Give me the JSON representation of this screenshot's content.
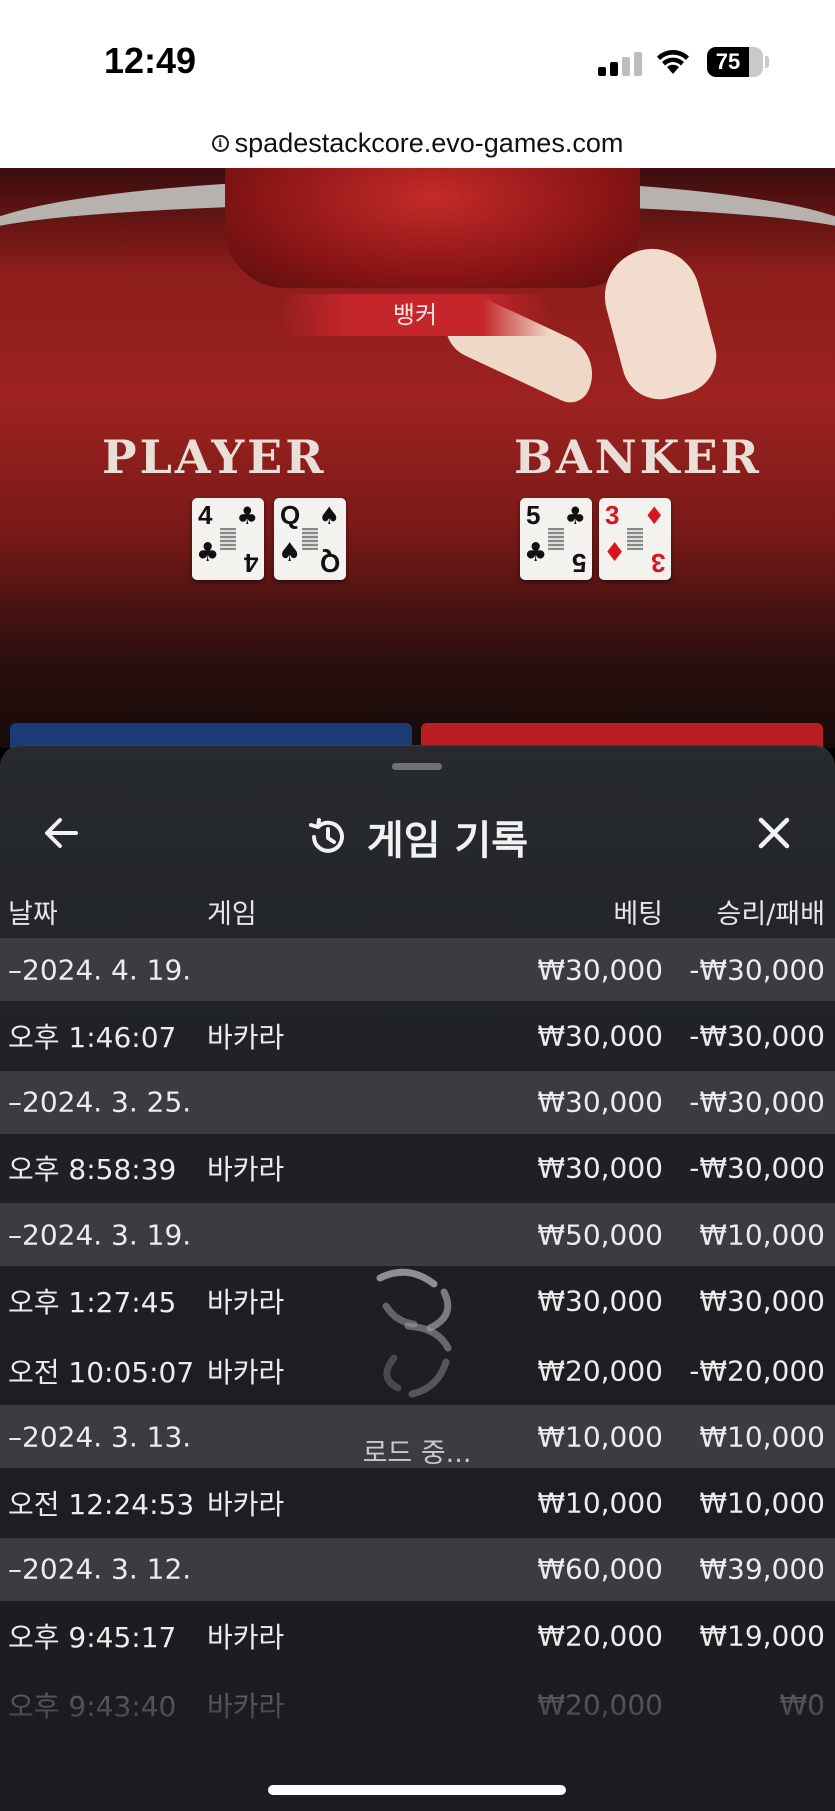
{
  "status_bar": {
    "time": "12:49",
    "battery": "75",
    "battery_level": 0.75
  },
  "browser": {
    "url": "spadestackcore.evo-games.com"
  },
  "game_view": {
    "dealer_tag": "뱅커",
    "player_label": "PLAYER",
    "banker_label": "BANKER",
    "player_cards": [
      {
        "rank": "4",
        "suit": "♣",
        "color": "black"
      },
      {
        "rank": "Q",
        "suit": "♠",
        "color": "black"
      }
    ],
    "banker_cards": [
      {
        "rank": "5",
        "suit": "♣",
        "color": "black"
      },
      {
        "rank": "3",
        "suit": "♦",
        "color": "red"
      }
    ],
    "colors": {
      "player": "#1c3a73",
      "banker": "#b81e24"
    }
  },
  "panel": {
    "title": "게임 기록",
    "columns": {
      "date": "날짜",
      "game": "게임",
      "bet": "베팅",
      "win_loss": "승리/패배"
    },
    "rows": [
      {
        "type": "day",
        "date": "–2024. 4. 19.",
        "game": "",
        "bet": "₩30,000",
        "pl": "-₩30,000"
      },
      {
        "type": "entry",
        "date": "오후 1:46:07",
        "game": "바카라",
        "bet": "₩30,000",
        "pl": "-₩30,000"
      },
      {
        "type": "day",
        "date": "–2024. 3. 25.",
        "game": "",
        "bet": "₩30,000",
        "pl": "-₩30,000"
      },
      {
        "type": "entry",
        "date": "오후 8:58:39",
        "game": "바카라",
        "bet": "₩30,000",
        "pl": "-₩30,000"
      },
      {
        "type": "day",
        "date": "–2024. 3. 19.",
        "game": "",
        "bet": "₩50,000",
        "pl": "₩10,000"
      },
      {
        "type": "entry",
        "date": "오후 1:27:45",
        "game": "바카라",
        "bet": "₩30,000",
        "pl": "₩30,000"
      },
      {
        "type": "entry",
        "date": "오전 10:05:07",
        "game": "바카라",
        "bet": "₩20,000",
        "pl": "-₩20,000"
      },
      {
        "type": "day",
        "date": "–2024. 3. 13.",
        "game": "",
        "bet": "₩10,000",
        "pl": "₩10,000"
      },
      {
        "type": "entry",
        "date": "오전 12:24:53",
        "game": "바카라",
        "bet": "₩10,000",
        "pl": "₩10,000"
      },
      {
        "type": "day",
        "date": "–2024. 3. 12.",
        "game": "",
        "bet": "₩60,000",
        "pl": "₩39,000"
      },
      {
        "type": "entry",
        "date": "오후 9:45:17",
        "game": "바카라",
        "bet": "₩20,000",
        "pl": "₩19,000"
      },
      {
        "type": "entry",
        "date": "오후 9:43:40",
        "game": "바카라",
        "bet": "₩20,000",
        "pl": "₩0",
        "faded": true
      }
    ],
    "loading_text": "로드 중..."
  }
}
